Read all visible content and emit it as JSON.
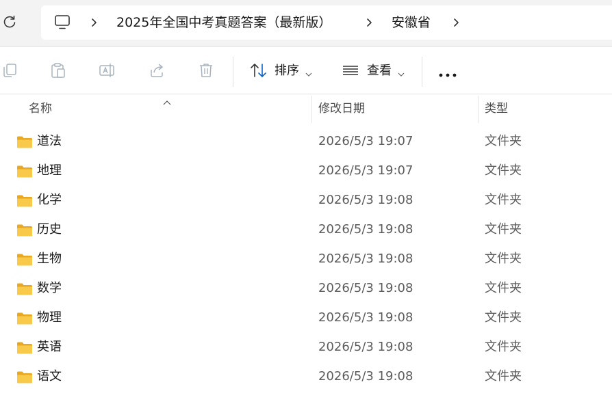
{
  "breadcrumb": {
    "items": [
      "2025年全国中考真题答案（最新版）",
      "安徽省"
    ]
  },
  "toolbar": {
    "sort_label": "排序",
    "view_label": "查看"
  },
  "columns": {
    "name": "名称",
    "date": "修改日期",
    "type": "类型"
  },
  "files": [
    {
      "name": "道法",
      "date": "2026/5/3 19:07",
      "type": "文件夹"
    },
    {
      "name": "地理",
      "date": "2026/5/3 19:07",
      "type": "文件夹"
    },
    {
      "name": "化学",
      "date": "2026/5/3 19:08",
      "type": "文件夹"
    },
    {
      "name": "历史",
      "date": "2026/5/3 19:08",
      "type": "文件夹"
    },
    {
      "name": "生物",
      "date": "2026/5/3 19:08",
      "type": "文件夹"
    },
    {
      "name": "数学",
      "date": "2026/5/3 19:08",
      "type": "文件夹"
    },
    {
      "name": "物理",
      "date": "2026/5/3 19:08",
      "type": "文件夹"
    },
    {
      "name": "英语",
      "date": "2026/5/3 19:08",
      "type": "文件夹"
    },
    {
      "name": "语文",
      "date": "2026/5/3 19:08",
      "type": "文件夹"
    }
  ],
  "icons": {
    "refresh": "refresh-icon",
    "computer": "computer-icon",
    "copy": "copy-icon",
    "paste": "paste-icon",
    "rename": "rename-icon",
    "share": "share-icon",
    "delete": "delete-icon",
    "sort": "sort-icon",
    "view": "view-icon",
    "more": "more-icon",
    "folder": "folder-icon"
  },
  "colors": {
    "folder_yellow": "#f9c94a",
    "folder_dark": "#e9a823",
    "accent_blue": "#0a64c8",
    "disabled_icon": "#a9b3bd"
  }
}
